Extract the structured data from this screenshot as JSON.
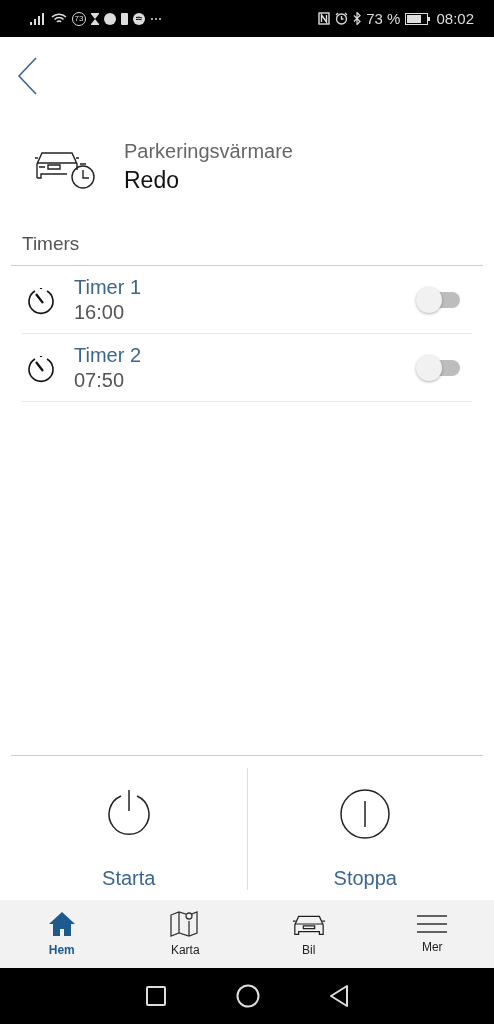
{
  "status_bar": {
    "notification_badge": "73",
    "battery_percent": "73 %",
    "time": "08:02"
  },
  "heater": {
    "title": "Parkeringsvärmare",
    "status": "Redo"
  },
  "timers": {
    "heading": "Timers",
    "items": [
      {
        "name": "Timer 1",
        "time": "16:00",
        "on": false
      },
      {
        "name": "Timer 2",
        "time": "07:50",
        "on": false
      }
    ]
  },
  "actions": [
    {
      "kind": "start",
      "label": "Starta"
    },
    {
      "kind": "stop",
      "label": "Stoppa"
    }
  ],
  "bottom_nav": [
    {
      "kind": "home",
      "label": "Hem",
      "selected": true
    },
    {
      "kind": "map",
      "label": "Karta",
      "selected": false
    },
    {
      "kind": "car",
      "label": "Bil",
      "selected": false
    },
    {
      "kind": "menu",
      "label": "Mer",
      "selected": false
    }
  ]
}
